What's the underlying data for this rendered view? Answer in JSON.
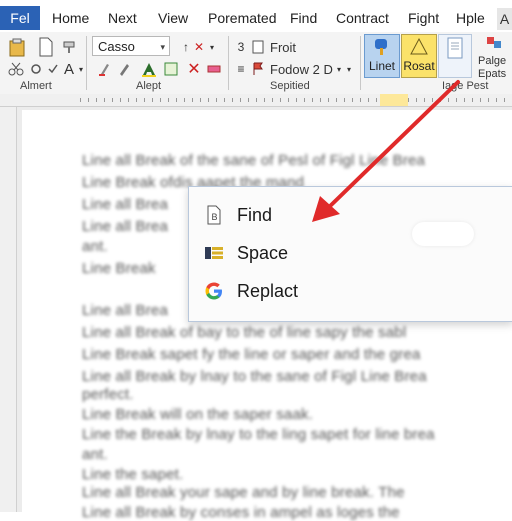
{
  "menu": {
    "file": "Fel",
    "items": [
      "Home",
      "Next",
      "View",
      "Poremated",
      "Find",
      "Contract",
      "Fight",
      "Hple"
    ],
    "end": "A"
  },
  "ribbon": {
    "font_name": "Casso",
    "groups": {
      "alignment": "Almert",
      "alpt": "Alept",
      "sepitied": "Sepitied",
      "page_pest": "Iage Pest"
    },
    "froit": "Froit",
    "fodow": "Fodow 2 D",
    "styles": {
      "linet": "Linet",
      "rosat": "Rosat"
    },
    "palge": "Palge",
    "epats": "Epats"
  },
  "popup": {
    "items": [
      {
        "label": "Find",
        "icon": "document-find-icon"
      },
      {
        "label": "Space",
        "icon": "space-grid-icon"
      },
      {
        "label": "Replact",
        "icon": "google-g-icon"
      }
    ]
  },
  "document": {
    "lines": [
      "Line all Break of the sane of Pesl of Figl Line Brea",
      "Line Break ofdis aapet the mand",
      "Line all Brea",
      "Line all Brea",
      "ant.",
      "Line Break",
      "Line all Brea",
      "Line all Break of bay to the of line sapy the sabl",
      "Line Break sapet fy the line or saper and the grea",
      "Line all Break by lnay to the sane of Figl Line Brea",
      "perfect.",
      "Line Break will on the saper saak.",
      "Line the Break by lnay to the ling sapet for line brea",
      "ant.",
      "Line the sapet.",
      "Line all Break your sape and by line break. The",
      "Line all Break by conses in ampel as loges the"
    ]
  },
  "colors": {
    "file_tab": "#2b62b5",
    "arrow": "#e02a2a",
    "style_highlight": "#fbe26a",
    "style_blue": "#b8d3ef"
  }
}
